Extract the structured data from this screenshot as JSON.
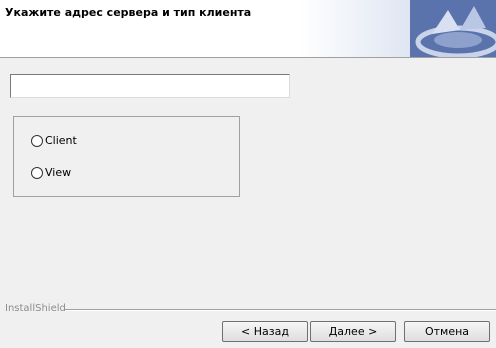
{
  "header": {
    "title": "Укажите адрес сервера и тип клиента"
  },
  "server_input": {
    "value": "",
    "placeholder": ""
  },
  "client_type": {
    "options": [
      {
        "label": "Client",
        "selected": false
      },
      {
        "label": "View",
        "selected": false
      }
    ]
  },
  "footer": {
    "brand": "InstallShield"
  },
  "buttons": {
    "back": "< Назад",
    "next": "Далее >",
    "cancel": "Отмена"
  },
  "colors": {
    "logo_blue": "#5a73ad",
    "background": "#f0f0f0"
  }
}
